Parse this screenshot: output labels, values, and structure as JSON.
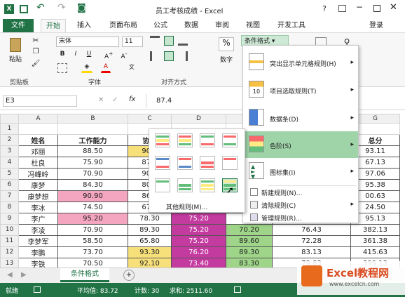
{
  "window": {
    "title": "员工考核成绩 - Excel",
    "user": "登录",
    "help": "?"
  },
  "tabs": [
    "文件",
    "开始",
    "插入",
    "页面布局",
    "公式",
    "数据",
    "审阅",
    "视图",
    "开发工具"
  ],
  "ribbon": {
    "paste": "粘贴",
    "font_name": "宋体",
    "font_size": "11",
    "bold": "B",
    "italic": "I",
    "underline": "U",
    "font_color_a": "A",
    "fill_a": "A",
    "groups": {
      "clipboard": "剪贴板",
      "font": "字体",
      "align": "对齐方式"
    },
    "number_label": "数字",
    "percent": "%",
    "cf_button": "条件格式"
  },
  "formula": {
    "cell": "E3",
    "value": "87.4",
    "fx": "fx"
  },
  "columns": [
    "A",
    "B",
    "C",
    "D",
    "E",
    "F",
    "G"
  ],
  "rows": [
    {
      "n": "1",
      "a": "",
      "b": "",
      "c": "",
      "d": "",
      "e": "",
      "f": "",
      "g": ""
    },
    {
      "n": "2",
      "a": "姓名",
      "b": "工作能力",
      "c": "协调",
      "d": "",
      "e": "",
      "f": "",
      "g": "总分"
    },
    {
      "n": "3",
      "a": "邓丽",
      "b": "88.50",
      "c": "90.9",
      "d": "",
      "e": "",
      "f": "",
      "g": "93.11"
    },
    {
      "n": "4",
      "a": "杜良",
      "b": "75.90",
      "c": "87.3",
      "d": "",
      "e": "",
      "f": "",
      "g": "67.13"
    },
    {
      "n": "5",
      "a": "冯峰岭",
      "b": "70.90",
      "c": "90.5",
      "d": "",
      "e": "",
      "f": "",
      "g": "97.06"
    },
    {
      "n": "6",
      "a": "康梦",
      "b": "84.30",
      "c": "80.9",
      "d": "",
      "e": "",
      "f": "",
      "g": "95.38"
    },
    {
      "n": "7",
      "a": "康梦想",
      "b": "90.90",
      "c": "86.2",
      "d": "",
      "e": "",
      "f": "",
      "g": "00.63"
    },
    {
      "n": "8",
      "a": "李冰",
      "b": "74.50",
      "c": "67.7",
      "d": "",
      "e": "",
      "f": "",
      "g": "24.50"
    },
    {
      "n": "9",
      "a": "李广",
      "b": "95.20",
      "c": "78.30",
      "d": "75.20",
      "e": "",
      "f": "",
      "g": "95.13"
    },
    {
      "n": "10",
      "a": "李凌",
      "b": "70.90",
      "c": "89.30",
      "d": "75.20",
      "e": "70.20",
      "f": "76.43",
      "g": "382.13"
    },
    {
      "n": "11",
      "a": "李梦军",
      "b": "58.50",
      "c": "65.80",
      "d": "75.20",
      "e": "89.60",
      "f": "72.28",
      "g": "361.38"
    },
    {
      "n": "12",
      "a": "李鹏",
      "b": "73.70",
      "c": "93.30",
      "d": "76.20",
      "e": "89.30",
      "f": "83.13",
      "g": "415.63"
    },
    {
      "n": "13",
      "a": "李铁",
      "b": "70.50",
      "c": "92.10",
      "d": "73.40",
      "e": "83.30",
      "f": "79.83",
      "g": "399.13"
    }
  ],
  "cf_menu": {
    "items": [
      "突出显示单元格规则(H)",
      "项目选取规则(T)",
      "数据条(D)",
      "色阶(S)",
      "图标集(I)",
      "新建规则(N)...",
      "清除规则(C)",
      "管理规则(R)..."
    ]
  },
  "colorscale": {
    "more": "其他规则(M)..."
  },
  "sheet": {
    "tab": "条件格式",
    "add": "+"
  },
  "status": {
    "ready": "就绪",
    "avg": "平均值: 83.72",
    "count": "计数: 30",
    "sum": "求和: 2511.60"
  },
  "watermark": {
    "text": "Excel教程网",
    "url": "www.excelcn.com"
  },
  "colors": {
    "excel_green": "#217346",
    "pink": "#f4a6c0",
    "yellow": "#f7e07a",
    "magenta": "#c43ba0",
    "green": "#9ed589"
  }
}
